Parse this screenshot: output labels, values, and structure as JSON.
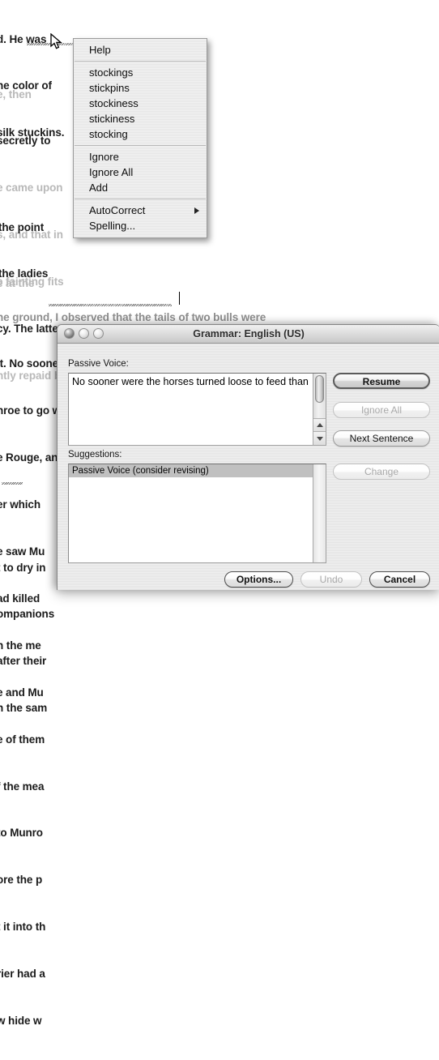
{
  "document": {
    "paragraphs": [
      {
        "id": "p1",
        "lines": [
          "d. He was",
          "he color of",
          "silk stuckins."
        ]
      },
      {
        "id": "p2",
        "lines": [
          "e, then",
          "secretly to",
          "e came upon",
          "s, and that in",
          "e fainting fits",
          "cy. The latter",
          "ntly repaid by"
        ]
      },
      {
        "id": "p3",
        "lines": [
          "the point",
          "the ladies"
        ]
      },
      {
        "id": "p4",
        "lines": [
          "e at the"
        ]
      },
      {
        "id": "p5",
        "lines": [
          "he ground, I observed that the tails of two bulls were",
          "it. No sooner were the horses turned loose to feed than",
          "nroe to go with him, took his rifle and walked quietly",
          "e Rouge, and it was about an hour after his",
          "er which",
          "e saw Mu",
          "ad killed",
          "n the me",
          "e and Mu",
          "e of them",
          "f the mea",
          "to Munro",
          "ore the p",
          "t it into th",
          "rier had a",
          "w hide w"
        ]
      },
      {
        "id": "p6",
        "lines": [
          "t to dry in",
          "ompanions",
          "after their",
          "n the sam"
        ]
      }
    ],
    "misspelled_word": "stuckins",
    "grammar_phrase": "were the horses turned"
  },
  "context_menu": {
    "help_label": "Help",
    "suggestions": [
      "stockings",
      "stickpins",
      "stockiness",
      "stickiness",
      "stocking"
    ],
    "actions": [
      "Ignore",
      "Ignore All",
      "Add"
    ],
    "footer": [
      "AutoCorrect",
      "Spelling..."
    ],
    "submenu_indicator": "submenu-arrow-icon"
  },
  "dialog": {
    "title": "Grammar: English (US)",
    "window_controls": {
      "close": "close-button",
      "minimize": "minimize-button",
      "zoom": "zoom-button"
    },
    "error_field": {
      "label": "Passive Voice:",
      "text": "No sooner were the horses turned loose to feed than"
    },
    "suggestions_field": {
      "label": "Suggestions:",
      "items": [
        "Passive Voice (consider revising)"
      ],
      "selected_index": 0
    },
    "side_buttons": [
      {
        "label": "Resume",
        "state": "default"
      },
      {
        "label": "Ignore All",
        "state": "disabled"
      },
      {
        "label": "Next Sentence",
        "state": "enabled"
      },
      {
        "label": "Change",
        "state": "disabled"
      }
    ],
    "bottom_buttons": [
      {
        "label": "Options...",
        "state": "strong"
      },
      {
        "label": "Undo",
        "state": "disabled"
      },
      {
        "label": "Cancel",
        "state": "strong"
      }
    ]
  },
  "colors": {
    "window_chrome": "#e9e9e9",
    "titlebar_top": "#f0f0f0",
    "titlebar_bottom": "#c8c8c8",
    "menu_bg": "#ececec",
    "selection_inactive": "#c0c0c0",
    "text": "#1b1b1b",
    "disabled_text": "#a9a9a9"
  }
}
